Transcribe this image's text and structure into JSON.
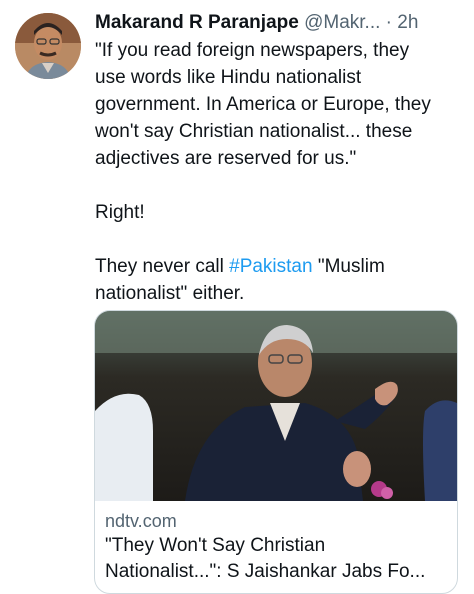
{
  "tweet": {
    "author_name": "Makarand R Paranjape",
    "handle": "@Makr...",
    "separator": "·",
    "time": "2h",
    "quote_lines": [
      "\"If you read foreign newspapers, they",
      "use words like Hindu nationalist",
      "government. In America or Europe, they",
      "won't say Christian nationalist... these",
      "adjectives are reserved for us.\""
    ],
    "reply_line": "Right!",
    "closing_line_1_before": "They never call ",
    "hashtag": "#Pakistan",
    "closing_line_1_after": " \"Muslim",
    "closing_line_2": "nationalist\" either."
  },
  "card": {
    "domain": "ndtv.com",
    "title_line_1": "\"They Won't Say Christian",
    "title_line_2": "Nationalist...\": S Jaishankar Jabs Fo..."
  },
  "colors": {
    "text": "#0f1419",
    "secondary": "#536471",
    "link": "#1d9bf0",
    "border": "#cfd9de"
  }
}
